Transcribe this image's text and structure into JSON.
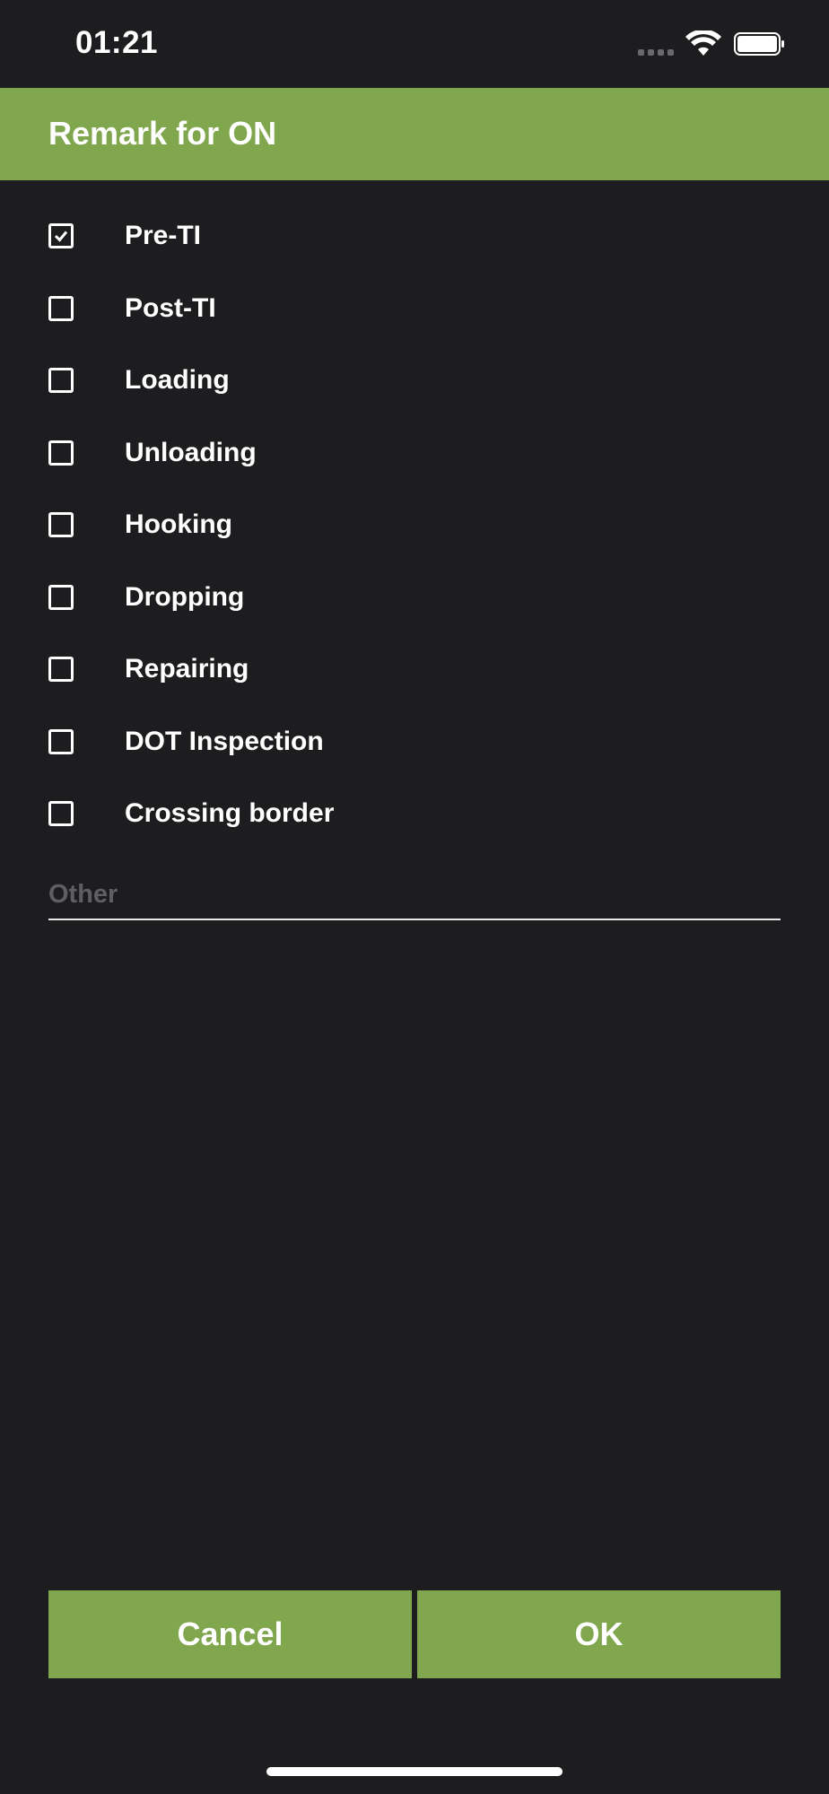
{
  "status_bar": {
    "time": "01:21",
    "signal_icon": "signal-dots-icon",
    "wifi_icon": "wifi-icon",
    "battery_icon": "battery-icon"
  },
  "header": {
    "title": "Remark for ON"
  },
  "options": [
    {
      "label": "Pre-TI",
      "checked": true
    },
    {
      "label": "Post-TI",
      "checked": false
    },
    {
      "label": "Loading",
      "checked": false
    },
    {
      "label": "Unloading",
      "checked": false
    },
    {
      "label": "Hooking",
      "checked": false
    },
    {
      "label": "Dropping",
      "checked": false
    },
    {
      "label": "Repairing",
      "checked": false
    },
    {
      "label": "DOT Inspection",
      "checked": false
    },
    {
      "label": "Crossing border",
      "checked": false
    }
  ],
  "other": {
    "placeholder": "Other",
    "value": ""
  },
  "buttons": {
    "cancel": "Cancel",
    "ok": "OK"
  },
  "colors": {
    "accent": "#80a74e",
    "background": "#1d1d1f"
  }
}
